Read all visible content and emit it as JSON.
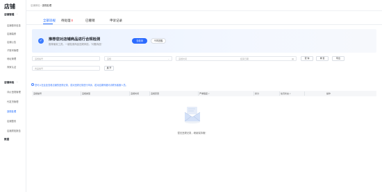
{
  "app": {
    "title": "店铺"
  },
  "sidebar": {
    "groups": [
      {
        "label": "店铺管理",
        "items": [
          "店铺基本信息",
          "店铺装修",
          "店铺公告",
          "子账号管理",
          "地址管理",
          "商家认证"
        ]
      },
      {
        "label": "店铺体检",
        "items": [
          "评价违规管理",
          "代发货管理",
          "违规处理",
          "店铺整改",
          "店铺质检报告"
        ]
      },
      {
        "label": "数据",
        "items": []
      }
    ]
  },
  "breadcrumb": {
    "parent": "店铺体检",
    "current": "违规处理"
  },
  "tabs": [
    {
      "label": "全部违规",
      "badge": ""
    },
    {
      "label": "待处理",
      "badge": "0"
    },
    {
      "label": "已撤销",
      "badge": ""
    },
    {
      "label": "申诉记录",
      "badge": ""
    }
  ],
  "banner": {
    "title": "推荐您对店铺商品进行合规检测",
    "subtitle": "推荐使用工具，一键检测商品违规风险，“问题商品”",
    "primary_button": "去检测",
    "secondary_button": "不再提醒"
  },
  "filters": {
    "violation_id_placeholder": "违规编号",
    "type_placeholder": "违规",
    "start_date_placeholder": "违规时间",
    "end_date_placeholder": "结束日期",
    "query_button": "查 询",
    "reset_button": "重 置",
    "export_button": "导出",
    "product_id_placeholder": "商品编号",
    "more_button": "展 开"
  },
  "tip": "您可以在此处查看店铺的违规记录，或对违规记录进行申诉，若对结果有疑问请联系客服人员。",
  "table": {
    "columns": [
      "违规编号",
      "违规类型",
      "违规时间",
      "违规原因",
      "严重程度",
      "扣分",
      "处罚状态",
      "操作"
    ]
  },
  "empty_state": {
    "text": "暂无违规记录，继续保持哦！"
  }
}
